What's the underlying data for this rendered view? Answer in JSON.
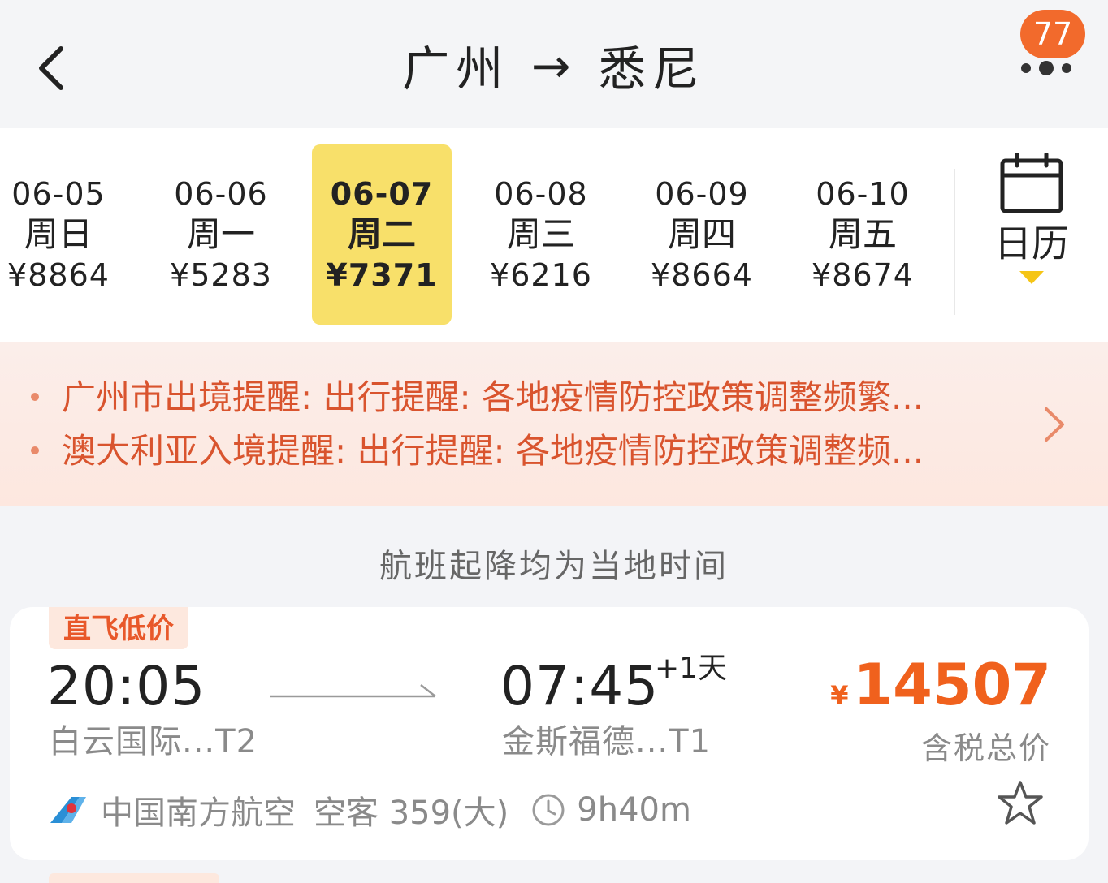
{
  "header": {
    "origin": "广州",
    "arrow": "→",
    "destination": "悉尼",
    "message_count": "77",
    "back_icon": "chevron-left-icon",
    "more_icon": "more-dots-icon"
  },
  "date_strip": {
    "dates": [
      {
        "date": "06-05",
        "weekday": "周日",
        "price": "¥8864",
        "selected": false
      },
      {
        "date": "06-06",
        "weekday": "周一",
        "price": "¥5283",
        "selected": false
      },
      {
        "date": "06-07",
        "weekday": "周二",
        "price": "¥7371",
        "selected": true
      },
      {
        "date": "06-08",
        "weekday": "周三",
        "price": "¥6216",
        "selected": false
      },
      {
        "date": "06-09",
        "weekday": "周四",
        "price": "¥8664",
        "selected": false
      },
      {
        "date": "06-10",
        "weekday": "周五",
        "price": "¥8674",
        "selected": false
      }
    ],
    "calendar_label": "日历",
    "calendar_icon": "calendar-icon"
  },
  "notices": [
    "广州市出境提醒: 出行提醒:  各地疫情防控政策调整频繁...",
    "澳大利亚入境提醒: 出行提醒:  各地疫情防控政策调整频..."
  ],
  "local_time_hint": "航班起降均为当地时间",
  "flight": {
    "tag": "直飞低价",
    "departure_time": "20:05",
    "departure_airport": "白云国际...T2",
    "arrival_time": "07:45",
    "day_offset": "+1天",
    "arrival_airport": "金斯福德...T1",
    "currency": "¥",
    "price": "14507",
    "price_note": "含税总价",
    "airline": "中国南方航空",
    "aircraft": "空客 359(大)",
    "duration": "9h40m"
  },
  "colors": {
    "accent_orange": "#f0611d",
    "selected_date_bg": "#f8e06a",
    "notice_text": "#d9542e",
    "badge": "#f26a2c"
  }
}
